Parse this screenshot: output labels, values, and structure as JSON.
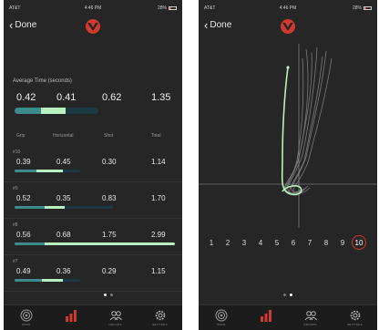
{
  "status": {
    "carrier": "AT&T",
    "time": "4:46 PM",
    "battery": "28%"
  },
  "nav": {
    "done_label": "Done"
  },
  "colors": {
    "background": "#262626",
    "bar_dark": "#1b3a44",
    "bar_mid": "#3b8a8c",
    "bar_light": "#b8f0c0",
    "accent_red": "#d03a2e",
    "trace_highlight": "#b8f0c0",
    "trace_other": "#8a8a8a"
  },
  "summary": {
    "title": "Average Time (seconds)",
    "values": [
      "0.42",
      "0.41",
      "0.62",
      "1.35"
    ],
    "bar_fractions": [
      0.31,
      0.3,
      0.0
    ]
  },
  "columns": [
    "Grip",
    "Horizontal",
    "Shot",
    "Total"
  ],
  "shots": [
    {
      "num": "#10",
      "values": [
        "0.39",
        "0.45",
        "0.30",
        "1.14"
      ]
    },
    {
      "num": "#9",
      "values": [
        "0.52",
        "0.35",
        "0.83",
        "1.70"
      ]
    },
    {
      "num": "#8",
      "values": [
        "0.56",
        "0.68",
        "1.75",
        "2.99"
      ]
    },
    {
      "num": "#7",
      "values": [
        "0.49",
        "0.36",
        "0.29",
        "1.15"
      ]
    }
  ],
  "pager": {
    "pages": 2,
    "active": 1
  },
  "tabs": [
    {
      "id": "train",
      "label": "TRAIN",
      "icon": "target-icon",
      "active": false
    },
    {
      "id": "stats",
      "label": "",
      "icon": "bar-chart-icon",
      "active": true
    },
    {
      "id": "groups",
      "label": "GROUPS",
      "icon": "group-icon",
      "active": false
    },
    {
      "id": "settings",
      "label": "SETTINGS",
      "icon": "gear-icon",
      "active": false
    }
  ],
  "trace": {
    "shot_numbers": [
      "1",
      "2",
      "3",
      "4",
      "5",
      "6",
      "7",
      "8",
      "9",
      "10"
    ],
    "selected_shot": "10"
  }
}
